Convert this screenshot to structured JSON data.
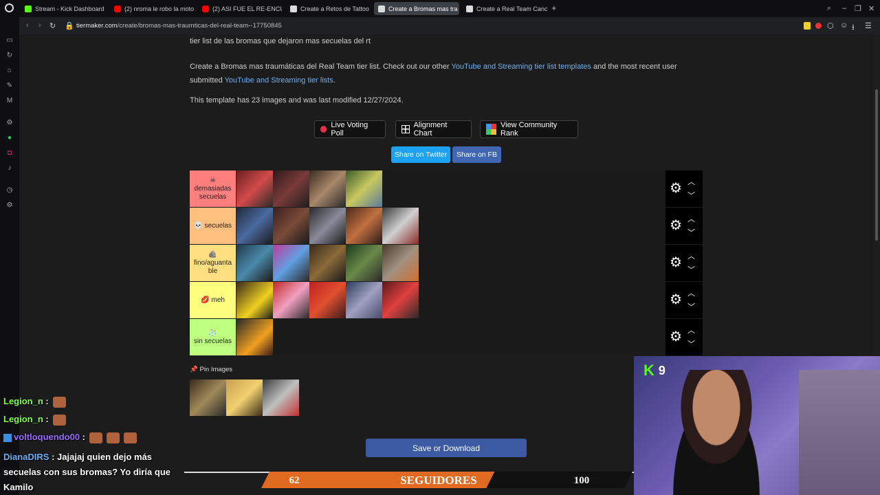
{
  "browser": {
    "tabs": [
      {
        "label": "Stream - Kick Dashboard",
        "favicon": "kick"
      },
      {
        "label": "(2) nroma le robo la moto",
        "favicon": "youtube"
      },
      {
        "label": "(2) ASI FUE EL RE-ENCUE",
        "favicon": "youtube"
      },
      {
        "label": "Create a Retos de Tattoo",
        "favicon": "tiermaker"
      },
      {
        "label": "Create a Bromas mas tra",
        "favicon": "tiermaker"
      },
      {
        "label": "Create a Real Team Canc",
        "favicon": "tiermaker"
      }
    ],
    "url_host": "tiermaker.com",
    "url_path": "/create/bromas-mas-traumticas-del-real-team--17750845"
  },
  "page": {
    "intro_text": "tier list de las bromas que dejaron mas secuelas del rt",
    "desc_prefix": "Create a Bromas mas traumáticas del Real Team tier list. Check out our other",
    "desc_link1": "YouTube and Streaming tier list templates",
    "desc_middle": "and the most recent user",
    "desc_line2_prefix": "submitted",
    "desc_link2": "YouTube and Streaming tier lists",
    "desc_suffix": ".",
    "template_info": "This template has 23 images and was last modified 12/27/2024.",
    "buttons": {
      "live_voting": "Live Voting Poll",
      "alignment": "Alignment Chart",
      "community_rank": "View Community Rank",
      "share_twitter": "Share on Twitter",
      "share_fb": "Share on FB",
      "save": "Save or Download"
    },
    "pin_label": "Pin Images"
  },
  "tiers": [
    {
      "emoji": "☠",
      "label": "demasiadas secuelas",
      "color": "#ff7f7f",
      "image_count": 4
    },
    {
      "emoji": "💀",
      "label": "secuelas",
      "color": "#ffbf7f",
      "image_count": 5
    },
    {
      "emoji": "🪨",
      "label": "fino/aguanta ble",
      "color": "#ffdf7f",
      "image_count": 5
    },
    {
      "emoji": "💋",
      "label": "meh",
      "color": "#ffff7f",
      "image_count": 5
    },
    {
      "emoji": "🧦",
      "label": "sin secuelas",
      "color": "#bfff7f",
      "image_count": 1
    }
  ],
  "chat": [
    {
      "user": "Legion_n",
      "color": "#7fff4f",
      "text": ""
    },
    {
      "user": "Legion_n",
      "color": "#7fff4f",
      "text": ""
    },
    {
      "user": "voltloquendo00",
      "color": "#9b6bff",
      "text": ""
    },
    {
      "user": "DianaDIRS",
      "color": "#6ab0f3",
      "text": "Jajajaj quien dejo más secuelas con sus bromas? Yo diría que Kamilo"
    }
  ],
  "overlay": {
    "followers_current": "62",
    "followers_label": "SEGUIDORES",
    "followers_goal": "100",
    "followers_progress": 0.62,
    "kick_viewers": "9"
  },
  "colors": {
    "twitter": "#1da1f2",
    "facebook": "#4267b2",
    "save": "#3b5aa3",
    "link": "#6ab0f3"
  }
}
